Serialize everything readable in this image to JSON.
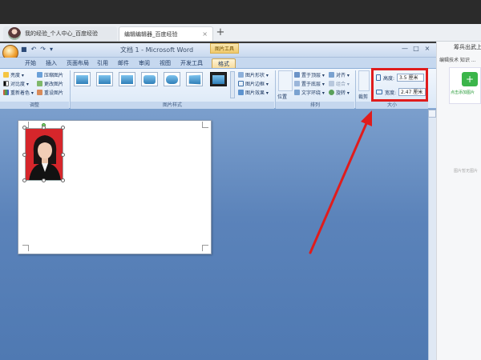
{
  "browser": {
    "tabs": [
      {
        "label": "我的经验_个人中心_百度经验"
      },
      {
        "label": "编辑编辑器_百度经验"
      }
    ],
    "close_glyph": "×",
    "new_tab_glyph": "+"
  },
  "side_panel": {
    "title": "筹兵出武上添加",
    "links": "编辑技术  知识  ...",
    "add_label": "点击添加图片",
    "empty_label": "图片暂无图片"
  },
  "word": {
    "title": "文档 1 - Microsoft Word",
    "picture_tools": "图片工具",
    "qat_icons": [
      "save-icon",
      "undo-icon",
      "redo-icon"
    ],
    "qat_glyphs": [
      "■",
      "↶",
      "↷",
      "▾"
    ],
    "window_glyphs": [
      "—",
      "□",
      "×"
    ],
    "ribbon_tabs": [
      "开始",
      "插入",
      "页面布局",
      "引用",
      "邮件",
      "审阅",
      "视图",
      "开发工具",
      "格式"
    ],
    "active_tab": "格式",
    "groups": {
      "adjust": {
        "label": "调整",
        "items": [
          "亮度 ▾",
          "对比度 ▾",
          "重新着色 ▾",
          "压缩图片",
          "更改图片",
          "重设图片"
        ]
      },
      "styles": {
        "label": "图片样式",
        "items": [
          "图片形状 ▾",
          "图片边框 ▾",
          "图片效果 ▾"
        ]
      },
      "arrange": {
        "label": "排列",
        "position_label": "位置",
        "items": [
          "置于顶层 ▾",
          "置于底层 ▾",
          "文字环绕 ▾",
          "对齐 ▾",
          "组合 ▾",
          "旋转 ▾"
        ]
      },
      "size": {
        "label": "大小",
        "crop_label": "裁剪",
        "height_label": "高度:",
        "height_value": "3.5 厘米",
        "width_label": "宽度:",
        "width_value": "2.47 厘米"
      }
    }
  },
  "colors": {
    "highlight_box": "#e01c1c",
    "arrow": "#e01c1c",
    "active_tab": "#f7dda0"
  }
}
